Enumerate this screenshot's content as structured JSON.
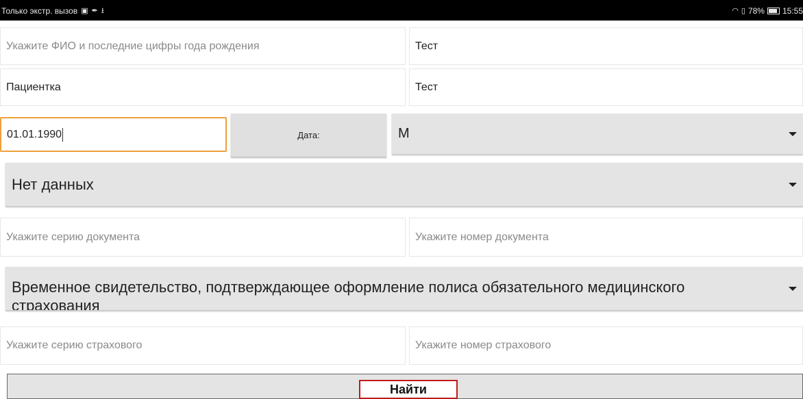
{
  "status_bar": {
    "carrier_text": "Только экстр. вызов",
    "battery_percent": "78%",
    "time": "15:55"
  },
  "form": {
    "fio_hint": "Укажите ФИО и последние цифры года рождения",
    "surname_value": "Тест",
    "name_value": "Пациентка",
    "patronymic_value": "Тест",
    "birthdate_value": "01.01.1990",
    "date_button_label": "Дата:",
    "gender_selected": "М",
    "document_type_selected": "Нет данных",
    "doc_series_placeholder": "Укажите серию документа",
    "doc_number_placeholder": "Укажите номер документа",
    "policy_type_selected": "Временное свидетельство, подтверждающее оформление полиса обязательного медицинского страхования",
    "policy_series_placeholder": "Укажите серию страхового",
    "policy_number_placeholder": "Укажите номер страхового",
    "find_button_label": "Найти"
  },
  "colors": {
    "active_border": "#ee9f3a",
    "find_border": "#c01a1a"
  }
}
